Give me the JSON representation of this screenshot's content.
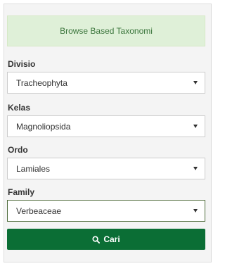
{
  "header": {
    "title": "Browse Based Taxonomi"
  },
  "fields": [
    {
      "label": "Divisio",
      "value": "Tracheophyta"
    },
    {
      "label": "Kelas",
      "value": "Magnoliopsida"
    },
    {
      "label": "Ordo",
      "value": "Lamiales"
    },
    {
      "label": "Family",
      "value": "Verbeaceae"
    }
  ],
  "search_button": {
    "label": "Cari",
    "icon": "search-icon"
  },
  "colors": {
    "header_bg": "#dff0d8",
    "header_text": "#3c763d",
    "button_bg": "#0b6e35"
  }
}
